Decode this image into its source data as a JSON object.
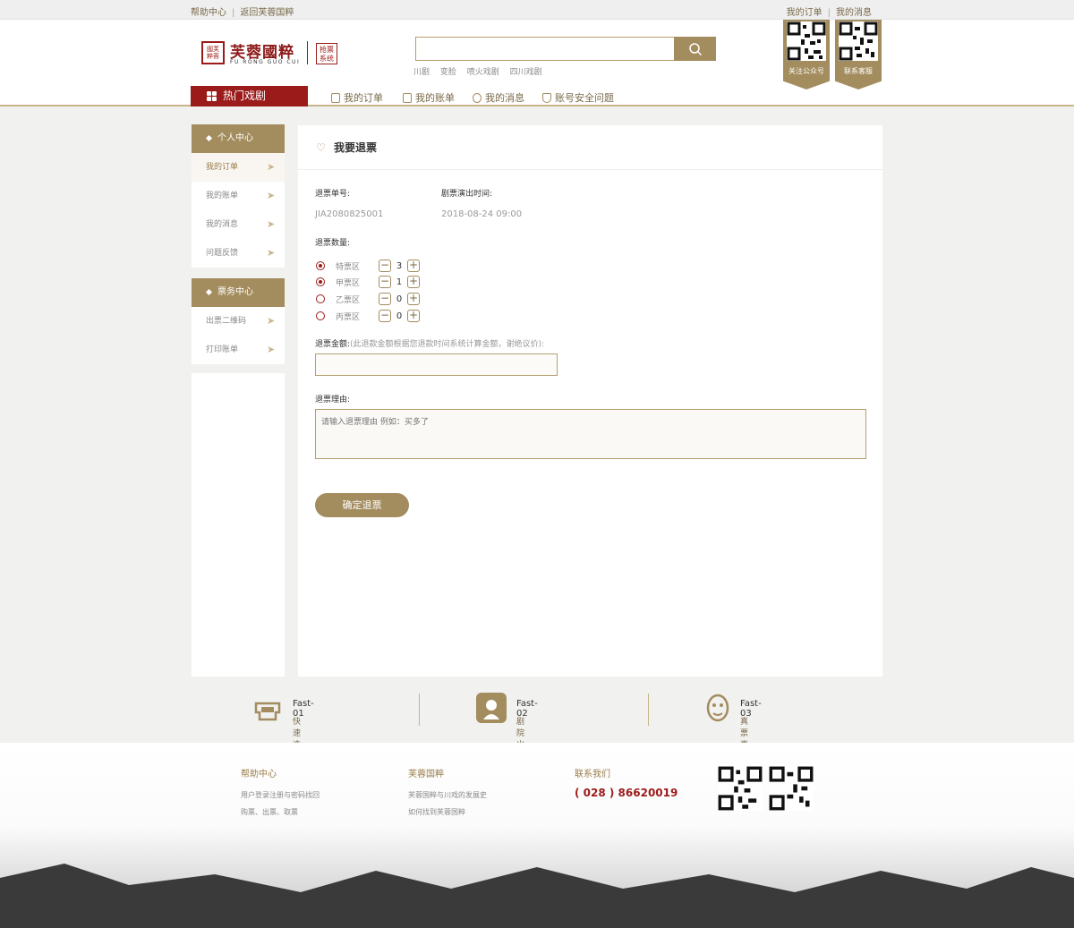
{
  "topbar": {
    "help": "帮助中心",
    "back": "返回芙蓉国粹",
    "orders": "我的订单",
    "messages": "我的消息"
  },
  "logo": {
    "name": "芙蓉國粹",
    "en": "FU RONG GUO CUI",
    "sub": "抢票系统",
    "seal": "國芙粹蓉"
  },
  "search": {
    "placeholder": "",
    "hotwords": [
      "川剧",
      "变脸",
      "喷火戏剧",
      "四川戏剧"
    ]
  },
  "qrcodes": {
    "official": "关注公众号",
    "service": "联系客服"
  },
  "nav": {
    "hot": "热门戏剧",
    "items": [
      "我的订单",
      "我的账单",
      "我的消息",
      "账号安全问题"
    ]
  },
  "sidebar": {
    "personal": "个人中心",
    "personal_items": [
      "我的订单",
      "我的账单",
      "我的消息",
      "问题反馈"
    ],
    "ticket": "票务中心",
    "ticket_items": [
      "出票二维码",
      "打印账单"
    ]
  },
  "refund": {
    "title": "我要退票",
    "no_label": "退票单号:",
    "no_value": "JIA2080825001",
    "time_label": "剧票演出时间:",
    "time_value": "2018-08-24 09:00",
    "qty_label": "退票数量:",
    "zones": [
      {
        "name": "特票区",
        "qty": "3",
        "selected": true
      },
      {
        "name": "甲票区",
        "qty": "1",
        "selected": true
      },
      {
        "name": "乙票区",
        "qty": "0",
        "selected": false
      },
      {
        "name": "丙票区",
        "qty": "0",
        "selected": false
      }
    ],
    "amount_label": "退票金额:",
    "amount_note": "(此退款金额根据您退款时间系统计算金额，谢绝议价):",
    "amount_value": "",
    "reason_label": "退票理由:",
    "reason_placeholder": "请输入退票理由 例如：买多了",
    "submit": "确定退票"
  },
  "features": [
    {
      "title": "Fast-01",
      "desc": "快速选座购票/选票"
    },
    {
      "title": "Fast-02",
      "desc": "剧院出票/取票"
    },
    {
      "title": "Fast-03",
      "desc": "真票真戏/保障"
    }
  ],
  "footer": {
    "help_title": "帮助中心",
    "help_links": [
      "用户登录注册与密码找回",
      "购票、出票、取票"
    ],
    "about_title": "芙蓉国粹",
    "about_links": [
      "芙蓉国粹与川戏的发展史",
      "如何找到芙蓉国粹"
    ],
    "contact_title": "联系我们",
    "phone": "( 028 ) 86620019"
  },
  "colors": {
    "gold": "#a38c5e",
    "red": "#9b1b1b"
  }
}
